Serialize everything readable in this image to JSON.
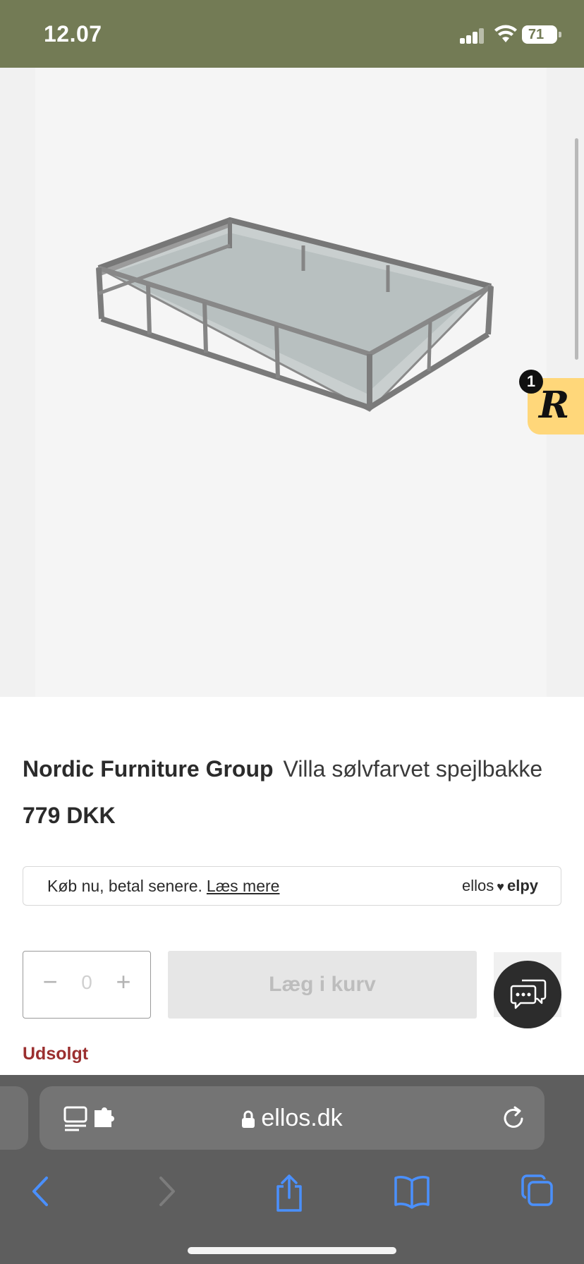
{
  "status_bar": {
    "time": "12.07",
    "battery": "71"
  },
  "product": {
    "brand": "Nordic Furniture Group",
    "name": "Villa sølvfarvet spejlbakke",
    "price": "779 DKK",
    "stock_status": "Udsolgt"
  },
  "loyalty_badge": {
    "letter": "R",
    "count": "1"
  },
  "bnpl": {
    "text": "Køb nu, betal senere.",
    "link": "Læs mere",
    "logo_left": "ellos",
    "logo_right": "elpy"
  },
  "quantity": {
    "minus": "−",
    "value": "0",
    "plus": "+"
  },
  "cart": {
    "add_label": "Læg i kurv"
  },
  "browser": {
    "url": "ellos.dk"
  },
  "colors": {
    "status_bar": "#737b55",
    "stock_status": "#9b2f2f",
    "loyalty_badge": "#ffd77a",
    "safari_icon_blue": "#4a90ff"
  },
  "icons": [
    "signal-icon",
    "wifi-icon",
    "battery-icon",
    "chat-icon",
    "lock-icon",
    "reload-icon",
    "page-menu-icon",
    "extension-icon",
    "back-icon",
    "forward-icon",
    "share-icon",
    "bookmarks-icon",
    "tabs-icon"
  ]
}
